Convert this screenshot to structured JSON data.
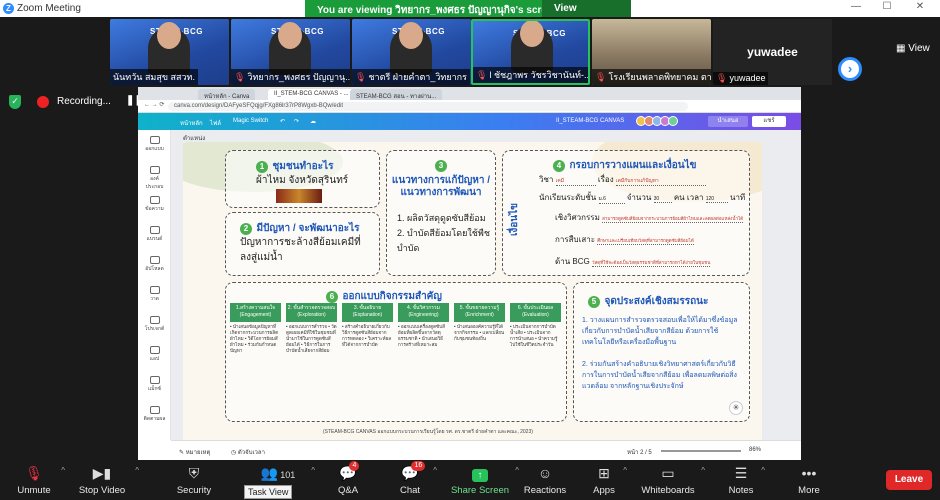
{
  "window": {
    "title": "Zoom Meeting"
  },
  "banner": {
    "message": "You are viewing วิทยากร_พงศธร ปัญญานุกิจ's screen",
    "view_options": "View Options"
  },
  "participants": [
    {
      "name": "นันทวัน สมสุข สสวท.",
      "muted": false
    },
    {
      "name": "วิทยากร_พงศธร ปัญญานุ...",
      "muted": true
    },
    {
      "name": "ชาตรี ฝ่ายคำตา_วิทยากร",
      "muted": true
    },
    {
      "name": "l ชัชฎาพร วัชรวิชานันท์-...",
      "muted": true
    },
    {
      "name": "โรงเรียนพลาดพิทยาคม ตาม...",
      "muted": true
    },
    {
      "name": "yuwadee",
      "label": "yuwadee",
      "muted": true
    }
  ],
  "view_button": "View",
  "recording": {
    "label": "Recording..."
  },
  "browser": {
    "tabs": [
      "หน้าหลัก - Canva",
      "II_STEM-BCG CANVAS - ...",
      "STEAM-BCG สอน - ทางผ่าน..."
    ],
    "url": "canva.com/design/DAFyeSFQqjg/FXg86lr37rP8Wgxb-BQw/edit"
  },
  "canva": {
    "menu": [
      "หน้าหลัก",
      "ไฟล์",
      "Magic Switch"
    ],
    "filename": "II_STEAM-BCG CANVAS",
    "present": "นำเสนอ",
    "share": "แชร์",
    "page_label": "ตำแหน่ง",
    "rail": [
      "ออกแบบ",
      "องค์ประกอบ",
      "ข้อความ",
      "แบรนด์",
      "อัปโหลด",
      "วาด",
      "โปรเจกต์",
      "แอป",
      "แม็กซ์",
      "ติดตามผล"
    ],
    "status": {
      "notes": "หมายเหตุ",
      "timer": "ตัวจับเวลา",
      "page": "หน้า 2 / 5",
      "zoom": "86%"
    }
  },
  "slide": {
    "box1": {
      "num": "1",
      "title": "ชุมชนทำอะไร",
      "text": "ผ้าไหม จังหวัดสุรินทร์"
    },
    "box2": {
      "num": "2",
      "title": "มีปัญหา / จะพัฒนาอะไร",
      "text": "ปัญหาการชะล้างสีย้อมเคมีที่ลงสู่แม่น้ำ"
    },
    "box3": {
      "num": "3",
      "title": "แนวทางการแก้ปัญหา / แนวทางการพัฒนา",
      "items": [
        "1. ผลิตวัสดุดูดซับสีย้อม",
        "2. บำบัดสีย้อมโดยใช้พืชบำบัด"
      ]
    },
    "box4": {
      "num": "4",
      "title": "กรอบการวางแผนและเงื่อนไข",
      "side": "เงื่อนไข",
      "subject_label": "วิชา",
      "subject_value": "เคมี",
      "topic_label": "เรื่อง",
      "topic_value": "เคมีกับการแก้ปัญหา",
      "level_label": "นักเรียนระดับชั้น",
      "level_value": "ม.6",
      "count_label": "จำนวน",
      "count_value": "30",
      "person_unit": "คน",
      "time_label": "เวลา",
      "time_value": "120",
      "time_unit": "นาที",
      "curriculum_label": "เชิงวิศวกรรม",
      "curriculum_value": "สามารถดูดซับสีย้อมจากกระบวนการย้อมสีผ้าไหมและลดผลต่อแหล่งน้ำได้",
      "env_label": "การสืบเสาะ",
      "env_value": "ศึกษาและเปรียบเทียบวัสดุที่สามารถดูดซับสีย้อมได้",
      "bcg_label": "ด้าน BCG",
      "bcg_value": "วัสดุที่ใช้จะต้องเป็นวัสดุธรรมชาติที่สามารถหาได้ง่ายในชุมชน"
    },
    "box5": {
      "num": "5",
      "title": "จุดประสงค์เชิงสมรรถนะ",
      "items": [
        "1. วางแผนการสำรวจตรวจสอบเพื่อให้ได้มาซึ่งข้อมูลเกี่ยวกับการบำบัดน้ำเสียจากสีย้อม ด้วยการใช้เทคโนโลยีหรือเครื่องมือพื้นฐาน",
        "2. ร่วมกันสร้างคำอธิบายเชิงวิทยาศาสตร์เกี่ยวกับวิธีการในการบำบัดน้ำเสียจากสีย้อม เพื่อลดมลพิษต่อสิ่งแวดล้อม จากหลักฐานเชิงประจักษ์"
      ]
    },
    "box6": {
      "num": "6",
      "title": "ออกแบบกิจกรรมสำคัญ",
      "phases": [
        {
          "head": "1.สร้างความสนใจ (Engagement)",
          "body": "• นำเสนอข้อมูลปัญหาที่เกิดจากกระบวนการผลิตผ้าไหม • วิดีโอการย้อมสีผ้าไหม • ร่วมกันกำหนดปัญหา"
        },
        {
          "head": "2. ขั้นสำรวจตรวจสอบ (Exploration)",
          "body": "• ออกแบบการสำรวจ • วัดดูดเผยเคมีที่ใช้ในชุมชนที่นำมาใช้ในการดูดซับสีย้อมได้ • วิธีการในการบำบัดน้ำเสียจากสีย้อม"
        },
        {
          "head": "3. ขั้นอธิบาย (Explanation)",
          "body": "• สร้างคำอธิบายเกี่ยวกับวิธีการดูดซับสีย้อมจากการทดลอง • วิเคราะห์ผลที่ได้จากการบำบัด"
        },
        {
          "head": "4. ขั้นวิศวกรรม (Engineering)",
          "body": "• ออกแบบเครื่องดูดซับสีย้อมที่ผลิตขึ้นจากวัสดุธรรมชาติ • นำเสนอวิธีการสร้างที่เหมาะสม"
        },
        {
          "head": "5. ขั้นขยายความรู้ (Enrichment)",
          "body": "• นำเสนอองค์ความรู้ที่ได้จากกิจกรรม • แลกเปลี่ยนกับชุมชนท้องถิ่น"
        },
        {
          "head": "6. ขั้นประเมินผล (Evaluation)",
          "body": "• ประเมินจากการบำบัดน้ำเสีย • ประเมินจากการนำเสนอ • นำความรู้ไปใช้ในชีวิตประจำวัน"
        }
      ]
    },
    "footer": "(STEAM-BCG CANVAS ออกแบบกระบวนการเรียนรู้โดย รศ. ดร.ชาตรี ฝ่ายคำตา และคณะ, 2023)"
  },
  "toolbar": {
    "items": [
      {
        "label": "Unmute",
        "icon": "mic-muted-icon"
      },
      {
        "label": "Stop Video",
        "icon": "video-icon"
      },
      {
        "label": "Security",
        "icon": "shield-icon"
      },
      {
        "label": "Participants",
        "count": "101",
        "icon": "people-icon"
      },
      {
        "label": "Q&A",
        "count": "4",
        "icon": "qa-icon"
      },
      {
        "label": "Chat",
        "count": "16",
        "icon": "chat-icon"
      },
      {
        "label": "Share Screen",
        "icon": "share-screen-icon"
      },
      {
        "label": "Reactions",
        "icon": "reactions-icon"
      },
      {
        "label": "Apps",
        "icon": "apps-icon"
      },
      {
        "label": "Whiteboards",
        "icon": "whiteboard-icon"
      },
      {
        "label": "Notes",
        "icon": "notes-icon"
      },
      {
        "label": "More",
        "icon": "more-icon"
      }
    ],
    "leave": "Leave",
    "tooltip": "Task View",
    "participants_suffix": "ts"
  },
  "colors": {
    "banner": "#1a9c3a",
    "leave": "#e02828",
    "zoom_blue": "#2d8cff",
    "share_green": "#27c25a"
  }
}
